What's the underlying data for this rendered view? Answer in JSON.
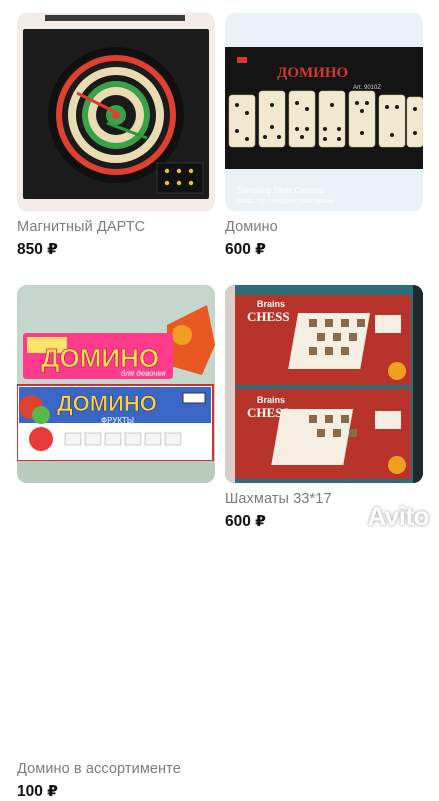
{
  "listings": [
    {
      "title": "Магнитный ДАРТС",
      "price": "850 ₽"
    },
    {
      "title": "Домино",
      "price": "600 ₽",
      "photo": {
        "box_text": "ДОМИНО",
        "art": "Art: 9010Z",
        "camera_line1": "Samsung Triple Camera",
        "camera_line2": "MAGIC TOYS/МЭДЖИК ТРЕК ПЕРМЬ"
      }
    },
    {
      "title": "Домино в ассортименте",
      "price": "100 ₽",
      "photo": {
        "box1_text": "ДОМИНО",
        "box1_sub": "для девочек",
        "box2_text": "ДОМИНО",
        "box2_sub": "ФРУКТЫ"
      }
    },
    {
      "title": "Шахматы 33*17",
      "price": "600 ₽",
      "photo": {
        "brand": "Brains",
        "product": "CHESS"
      }
    }
  ],
  "watermark": {
    "text": "Avito"
  },
  "colors": {
    "price": "#111111",
    "title": "#7b7b7b",
    "accent": "#00aaff"
  }
}
